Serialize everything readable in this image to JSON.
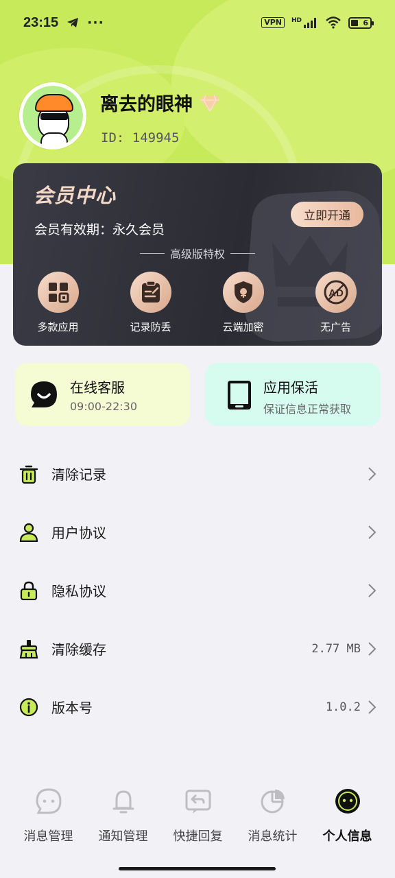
{
  "status_bar": {
    "time": "23:15",
    "vpn": "VPN",
    "network": "HD",
    "battery": "6"
  },
  "profile": {
    "name": "离去的眼神",
    "id_text": "ID: 149945"
  },
  "vip": {
    "title": "会员中心",
    "validity": "会员有效期：永久会员",
    "open_button": "立即开通",
    "section_title": "高级版特权",
    "features": [
      {
        "label": "多款应用",
        "icon": "grid-apps-icon"
      },
      {
        "label": "记录防丢",
        "icon": "clipboard-icon"
      },
      {
        "label": "云端加密",
        "icon": "shield-lock-icon"
      },
      {
        "label": "无广告",
        "icon": "ad-icon"
      }
    ]
  },
  "tiles": {
    "service": {
      "title": "在线客服",
      "subtitle": "09:00-22:30"
    },
    "keepalive": {
      "title": "应用保活",
      "subtitle": "保证信息正常获取"
    }
  },
  "menu": [
    {
      "label": "清除记录",
      "icon": "trash-icon",
      "value": ""
    },
    {
      "label": "用户协议",
      "icon": "user-icon",
      "value": ""
    },
    {
      "label": "隐私协议",
      "icon": "lock-icon",
      "value": ""
    },
    {
      "label": "清除缓存",
      "icon": "broom-icon",
      "value": "2.77 MB"
    },
    {
      "label": "版本号",
      "icon": "info-icon",
      "value": "1.0.2"
    }
  ],
  "tabs": [
    {
      "label": "消息管理",
      "icon": "chat-icon"
    },
    {
      "label": "通知管理",
      "icon": "bell-icon"
    },
    {
      "label": "快捷回复",
      "icon": "reply-icon"
    },
    {
      "label": "消息统计",
      "icon": "pie-chart-icon"
    },
    {
      "label": "个人信息",
      "icon": "profile-face-icon",
      "active": true
    }
  ],
  "colors": {
    "accent": "#c7ea5b",
    "vip_card": "#2f2f38",
    "vip_gold": "#f4d9c6",
    "tile_service": "#f5fbd2",
    "tile_keepalive": "#d6fbef"
  }
}
